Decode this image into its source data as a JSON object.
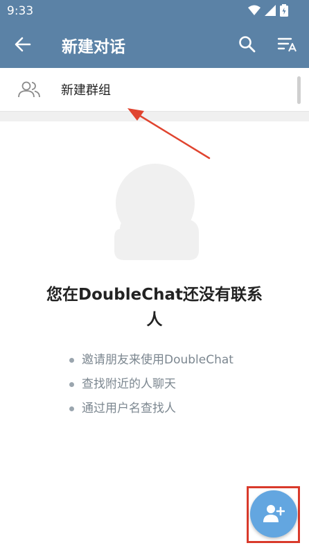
{
  "status_bar": {
    "time": "9:33",
    "icons": [
      "wifi-icon",
      "signal-icon",
      "battery-icon"
    ]
  },
  "app_bar": {
    "title": "新建对话",
    "back_icon": "arrow-left-icon",
    "search_icon": "search-icon",
    "sort_icon": "sort-icon"
  },
  "new_group": {
    "label": "新建群组",
    "icon": "group-icon"
  },
  "empty_state": {
    "title": "您在DoubleChat还没有联系人",
    "tips": [
      "邀请朋友来使用DoubleChat",
      "查找附近的人聊天",
      "通过用户名查找人"
    ]
  },
  "fab": {
    "icon": "add-contact-icon"
  },
  "colors": {
    "header": "#5b82a6",
    "fab": "#63a6e0",
    "annotation": "#d93a2b"
  }
}
